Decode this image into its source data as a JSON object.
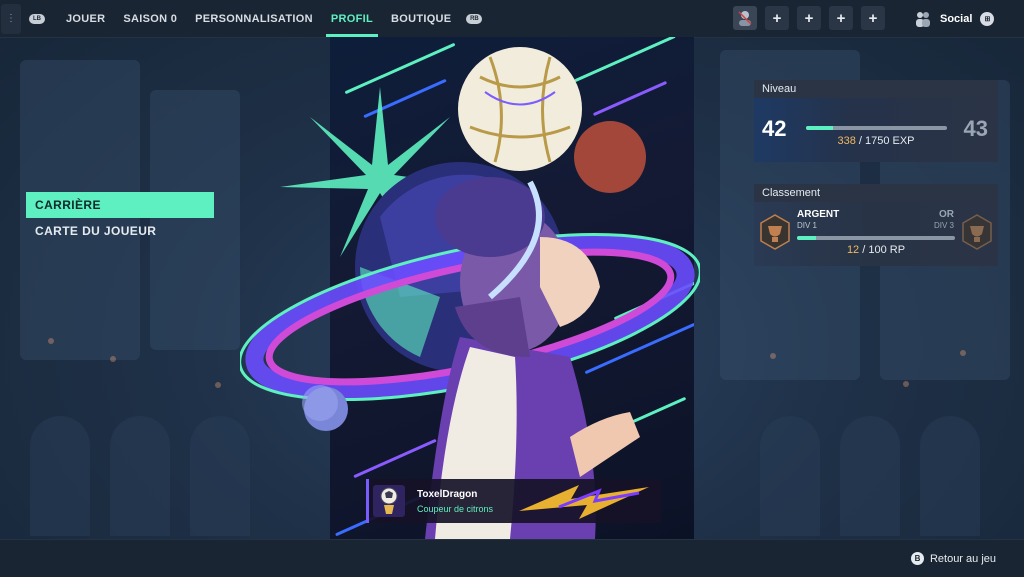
{
  "topbar": {
    "menu_icon": "grip-dots-icon",
    "left_shoulder": "LB",
    "right_shoulder": "RB",
    "tabs": [
      {
        "label": "JOUER"
      },
      {
        "label": "SAISON 0"
      },
      {
        "label": "PERSONNALISATION"
      },
      {
        "label": "PROFIL",
        "active": true
      },
      {
        "label": "BOUTIQUE"
      }
    ],
    "party_slots": [
      {
        "icon": "player-avatar-icon"
      },
      {
        "icon": "plus-icon",
        "glyph": "+"
      },
      {
        "icon": "plus-icon",
        "glyph": "+"
      },
      {
        "icon": "plus-icon",
        "glyph": "+"
      },
      {
        "icon": "plus-icon",
        "glyph": "+"
      }
    ],
    "social_label": "Social",
    "social_icon": "friends-icon"
  },
  "side_menu": {
    "items": [
      {
        "label": "CARRIÈRE",
        "active": true
      },
      {
        "label": "CARTE DU JOUEUR",
        "active": false
      }
    ]
  },
  "player_card": {
    "name": "ToxelDragon",
    "title": "Coupeur de citrons",
    "avatar_icon": "ball-trophy-icon",
    "banner_icon": "lightning-bolt-icon"
  },
  "level": {
    "header": "Niveau",
    "current": "42",
    "next": "43",
    "exp_current": "338",
    "exp_sep": " / 1750 EXP",
    "exp_progress": 0.193
  },
  "ranking": {
    "header": "Classement",
    "current_rank": "ARGENT",
    "current_div": "DIV 1",
    "next_rank": "OR",
    "next_div": "DIV 3",
    "rp_current": "12",
    "rp_sep": " / 100 RP",
    "rp_progress": 0.12,
    "current_icon": "silver-rank-icon",
    "next_icon": "gold-rank-icon"
  },
  "bottombar": {
    "back_button_glyph": "B",
    "back_label": "Retour au jeu"
  },
  "colors": {
    "accent": "#5ef0c0",
    "gold": "#f0b860",
    "bar_bg": "#1a2533"
  }
}
